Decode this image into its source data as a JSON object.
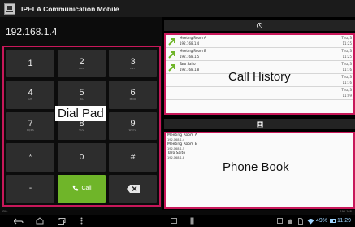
{
  "app": {
    "title": "IPELA Communication Mobile"
  },
  "dialer": {
    "number": "192.168.1.4",
    "keys": [
      {
        "digit": "1",
        "letters": ""
      },
      {
        "digit": "2",
        "letters": "ABC"
      },
      {
        "digit": "3",
        "letters": "DEF"
      },
      {
        "digit": "4",
        "letters": "GHI"
      },
      {
        "digit": "5",
        "letters": "JKL"
      },
      {
        "digit": "6",
        "letters": "MNO"
      },
      {
        "digit": "7",
        "letters": "PQRS"
      },
      {
        "digit": "8",
        "letters": "TUV"
      },
      {
        "digit": "9",
        "letters": "WXYZ"
      },
      {
        "digit": "*",
        "letters": ""
      },
      {
        "digit": "0",
        "letters": ""
      },
      {
        "digit": "#",
        "letters": ""
      },
      {
        "digit": "-",
        "letters": ""
      }
    ],
    "call_label": "Call",
    "label": "Dial Pad"
  },
  "history": {
    "label": "Call History",
    "header_icon": "history-icon",
    "entries": [
      {
        "name": "Meeting Room A",
        "ip": "192.168.1.4",
        "date": "Thu, 3",
        "time": "11:25"
      },
      {
        "name": "Meeting Room B",
        "ip": "192.168.1.5",
        "date": "Thu, 3",
        "time": "11:25"
      },
      {
        "name": "Taro Saito",
        "ip": "192.168.1.8",
        "date": "Thu, 3",
        "time": "11:16"
      },
      {
        "name": "",
        "ip": "",
        "date": "Thu, 3",
        "time": "11:16"
      },
      {
        "name": "",
        "ip": "",
        "date": "Thu, 3",
        "time": "11:09"
      }
    ]
  },
  "phonebook": {
    "label": "Phone Book",
    "header_icon": "contacts-icon",
    "entries": [
      {
        "name": "Meeting Room A",
        "ip": "192.168.1.4"
      },
      {
        "name": "Meeting Room B",
        "ip": "192.168.1.5"
      },
      {
        "name": "Taro Saito",
        "ip": "192.168.1.8"
      }
    ]
  },
  "status_strip": {
    "left": "SIP: -",
    "right": "192.168."
  },
  "status_bar": {
    "battery": "49%",
    "time": "11:29"
  },
  "colors": {
    "highlight": "#c8185a",
    "call": "#6fb529",
    "accent": "#4b9bc7"
  }
}
